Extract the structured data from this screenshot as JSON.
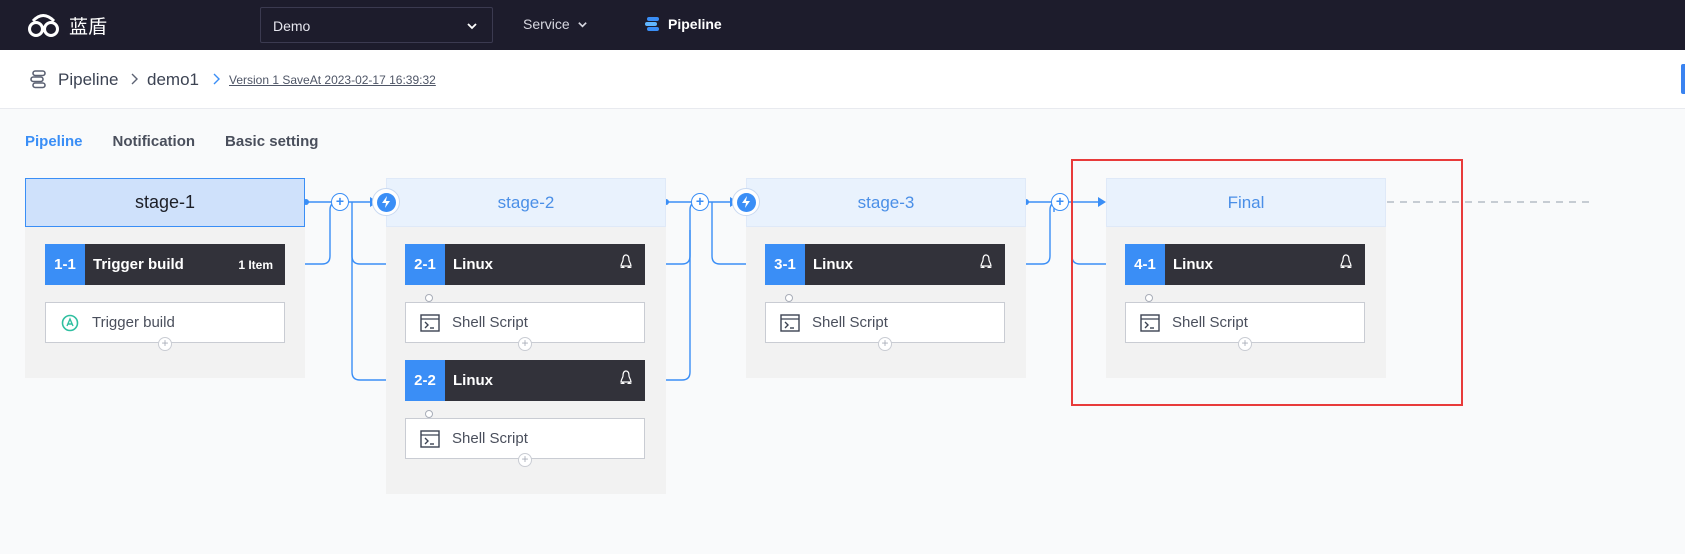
{
  "topnav": {
    "logo_text": "蓝盾",
    "project_select": "Demo",
    "service_label": "Service",
    "pipeline_label": "Pipeline"
  },
  "breadcrumb": {
    "root": "Pipeline",
    "pipeline_name": "demo1",
    "version": "Version 1 SaveAt 2023-02-17 16:39:32"
  },
  "tabs": [
    "Pipeline",
    "Notification",
    "Basic setting"
  ],
  "stages": [
    {
      "title": "stage-1",
      "jobs": [
        {
          "num": "1-1",
          "name": "Trigger build",
          "badge": "1 Item",
          "tasks": [
            "Trigger build"
          ]
        }
      ]
    },
    {
      "title": "stage-2",
      "jobs": [
        {
          "num": "2-1",
          "name": "Linux",
          "tasks": [
            "Shell Script"
          ]
        },
        {
          "num": "2-2",
          "name": "Linux",
          "tasks": [
            "Shell Script"
          ]
        }
      ]
    },
    {
      "title": "stage-3",
      "jobs": [
        {
          "num": "3-1",
          "name": "Linux",
          "tasks": [
            "Shell Script"
          ]
        }
      ]
    },
    {
      "title": "Final",
      "jobs": [
        {
          "num": "4-1",
          "name": "Linux",
          "tasks": [
            "Shell Script"
          ]
        }
      ]
    }
  ],
  "add_symbol": "+",
  "colors": {
    "nav_bg": "#1d1c2c",
    "accent": "#3a8ef6",
    "job_bg": "#32323a",
    "highlight": "#e83a3a"
  }
}
